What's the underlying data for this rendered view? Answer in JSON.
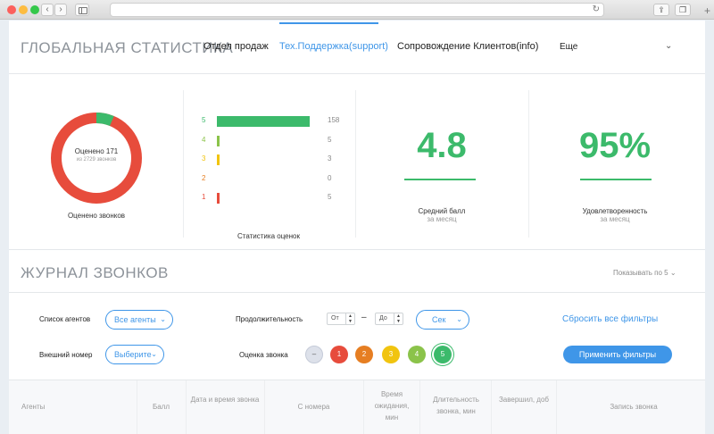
{
  "header": {
    "title": "ГЛОБАЛЬНАЯ СТАТИСТИКА",
    "tabs": [
      {
        "label": "Отдел продаж"
      },
      {
        "label": "Тех.Поддержка(support)"
      },
      {
        "label": "Сопровождение Клиентов(info)"
      }
    ],
    "more": "Еще"
  },
  "stats": {
    "donut": {
      "main": "Оценено 171",
      "sub": "из 2729 звонков",
      "caption": "Оценено звонков",
      "rated_fraction": 0.063,
      "colors": {
        "rated": "#3cba6b",
        "rest": "#e74c3c"
      }
    },
    "ratings": {
      "caption": "Статистика оценок",
      "rows": [
        {
          "label": "5",
          "value": "158",
          "count": 158,
          "color": "#3cba6b"
        },
        {
          "label": "4",
          "value": "5",
          "count": 5,
          "color": "#8bc34a"
        },
        {
          "label": "3",
          "value": "3",
          "count": 3,
          "color": "#f1c40f"
        },
        {
          "label": "2",
          "value": "0",
          "count": 0,
          "color": "#e67e22"
        },
        {
          "label": "1",
          "value": "5",
          "count": 5,
          "color": "#e74c3c"
        }
      ],
      "max": 158
    },
    "avg": {
      "value": "4.8",
      "caption": "Средний балл",
      "sub": "за месяц"
    },
    "satisfaction": {
      "value": "95%",
      "caption": "Удовлетворенность",
      "sub": "за месяц"
    }
  },
  "journal": {
    "title": "ЖУРНАЛ ЗВОНКОВ",
    "perpage": "Показывать по 5",
    "filters": {
      "agents_label": "Список агентов",
      "agents_value": "Все агенты",
      "duration_label": "Продолжительность",
      "from_placeholder": "От",
      "to_placeholder": "До",
      "dash": "–",
      "unit_value": "Сек",
      "reset": "Сбросить все фильтры",
      "external_label": "Внешний номер",
      "external_value": "Выберите",
      "rating_label": "Оценка звонка",
      "rating_options": [
        {
          "label": "–",
          "color": "#dde1ea",
          "text": "#555"
        },
        {
          "label": "1",
          "color": "#e74c3c",
          "text": "#ffffff"
        },
        {
          "label": "2",
          "color": "#e67e22",
          "text": "#ffffff"
        },
        {
          "label": "3",
          "color": "#f1c40f",
          "text": "#ffffff"
        },
        {
          "label": "4",
          "color": "#8bc34a",
          "text": "#ffffff"
        },
        {
          "label": "5",
          "color": "#3cba6b",
          "text": "#ffffff"
        }
      ],
      "apply": "Применить фильтры"
    },
    "columns": [
      {
        "label": "Агенты"
      },
      {
        "label": "Балл"
      },
      {
        "label": "Дата и время звонка"
      },
      {
        "label": "С номера"
      },
      {
        "label": "Время ожидания, мин"
      },
      {
        "label": "Длительность звонка, мин"
      },
      {
        "label": "Завершил, доб"
      },
      {
        "label": "Запись звонка"
      }
    ]
  }
}
